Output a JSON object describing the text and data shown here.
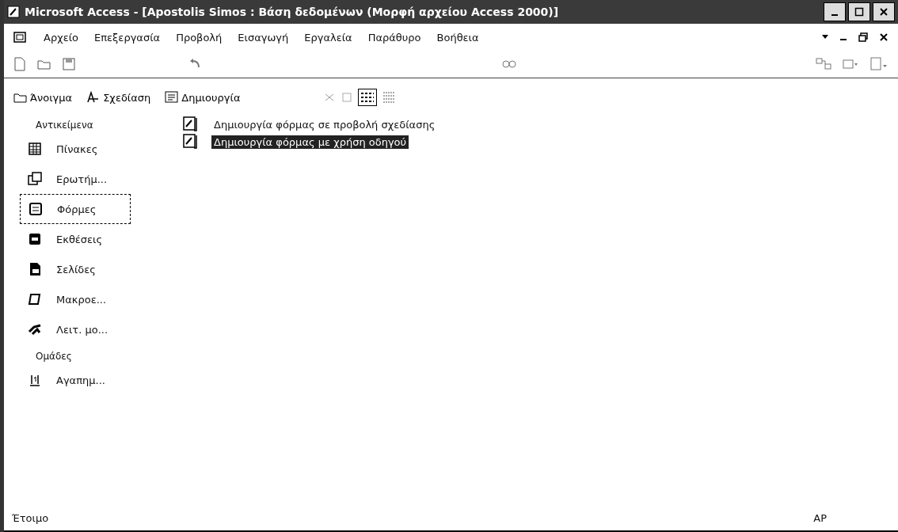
{
  "window": {
    "title": "Microsoft Access - [Apostolis Simos : Βάση δεδομένων (Μορφή αρχείου Access 2000)]"
  },
  "menu": [
    "Αρχείο",
    "Επεξεργασία",
    "Προβολή",
    "Εισαγωγή",
    "Εργαλεία",
    "Παράθυρο",
    "Βοήθεια"
  ],
  "db_toolbar": [
    {
      "label": "Άνοιγμα"
    },
    {
      "label": "Σχεδίαση"
    },
    {
      "label": "Δημιουργία"
    }
  ],
  "sidebar": {
    "header": "Αντικείμενα",
    "items": [
      {
        "label": "Πίνακες",
        "selected": false
      },
      {
        "label": "Ερωτήμ...",
        "selected": false
      },
      {
        "label": "Φόρμες",
        "selected": true
      },
      {
        "label": "Εκθέσεις",
        "selected": false
      },
      {
        "label": "Σελίδες",
        "selected": false
      },
      {
        "label": "Μακροε...",
        "selected": false
      },
      {
        "label": "Λειτ. μο...",
        "selected": false
      }
    ],
    "groups_header": "Ομάδες",
    "groups": [
      {
        "label": "Αγαπημ...",
        "selected": false
      }
    ]
  },
  "list": [
    {
      "label": "Δημιουργία φόρμας σε προβολή σχεδίασης",
      "selected": false
    },
    {
      "label": "Δημιουργία φόρμας με χρήση οδηγού",
      "selected": true
    }
  ],
  "status_bar": {
    "text": "Έτοιμο",
    "indicator": "ΑΡ"
  }
}
